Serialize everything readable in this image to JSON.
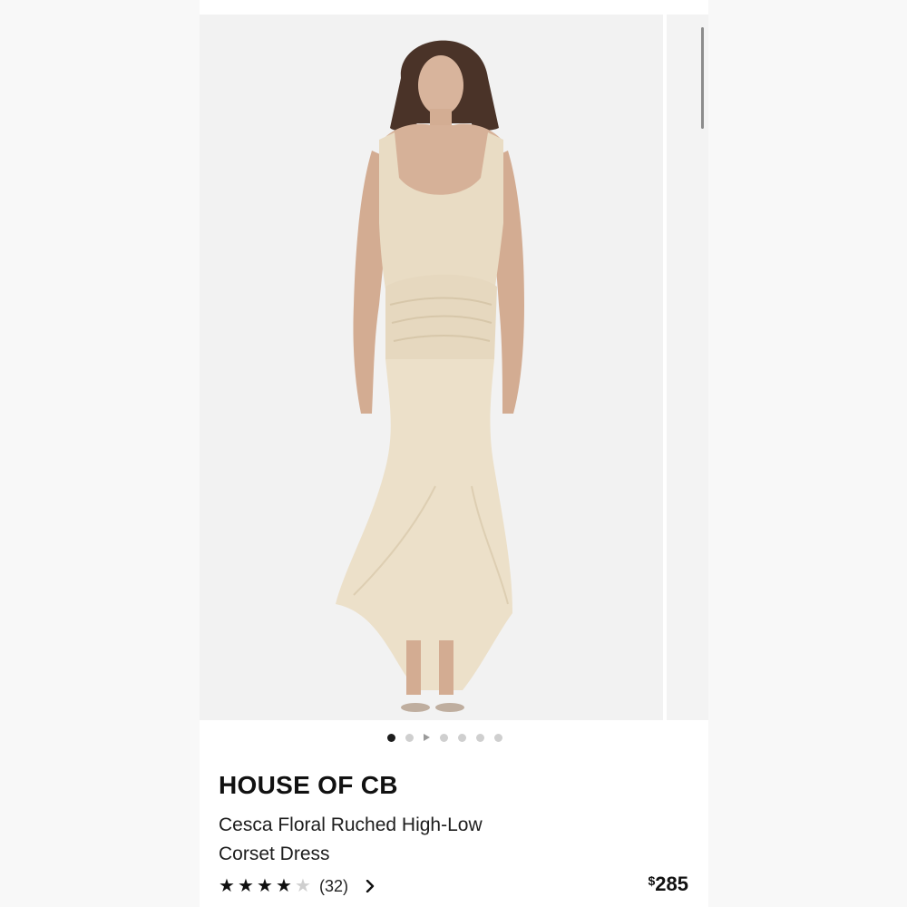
{
  "product": {
    "brand": "HOUSE OF CB",
    "name": "Cesca Floral Ruched High-Low Corset Dress",
    "rating": 4,
    "rating_max": 5,
    "review_count": "(32)",
    "price_currency": "$",
    "price_amount": "285"
  },
  "gallery": {
    "active_index": 0,
    "slide_count": 7,
    "has_video_indicator": true,
    "image_alt": "product-photo"
  },
  "colors": {
    "dress": "#e9dcc4",
    "background": "#f2f2f2",
    "text": "#111111",
    "dot_active": "#1d1d1d",
    "dot_inactive": "#cfcfcf"
  },
  "icons": {
    "star": "star-icon",
    "chevron": "chevron-right-icon",
    "play": "play-icon"
  }
}
